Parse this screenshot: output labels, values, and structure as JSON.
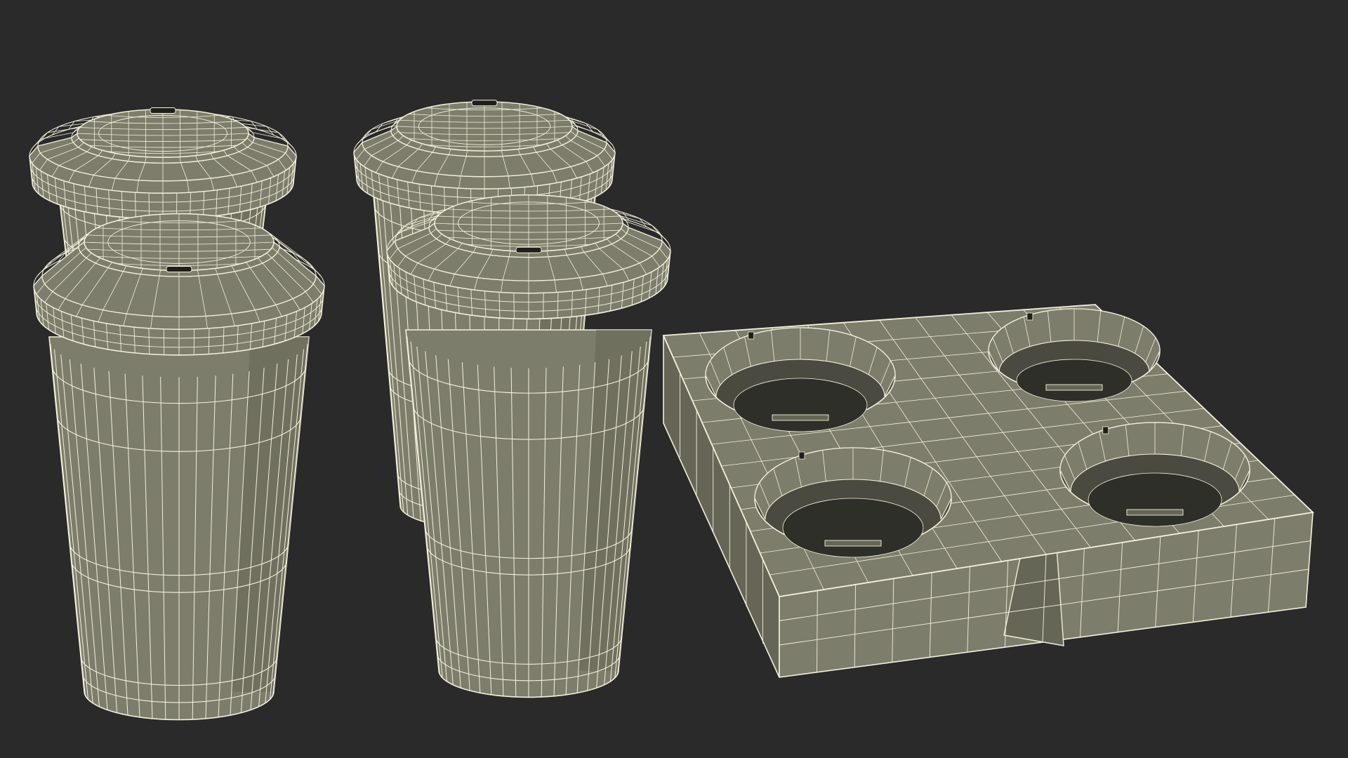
{
  "scene": {
    "background": "#2a2a2a",
    "model_fill": "#7d7d6c",
    "model_fill_dark": "#666656",
    "model_fill_shadow": "#4a4a40",
    "wire_color": "#f3f1dc",
    "lid_slot_color": "#1f1f1a",
    "objects": [
      {
        "name": "cup-back-left",
        "kind": "coffee-cup"
      },
      {
        "name": "cup-front-left",
        "kind": "coffee-cup"
      },
      {
        "name": "cup-back-middle",
        "kind": "coffee-cup"
      },
      {
        "name": "cup-front-middle",
        "kind": "coffee-cup"
      },
      {
        "name": "cup-carrier-tray",
        "kind": "four-cup-carrier"
      }
    ]
  }
}
